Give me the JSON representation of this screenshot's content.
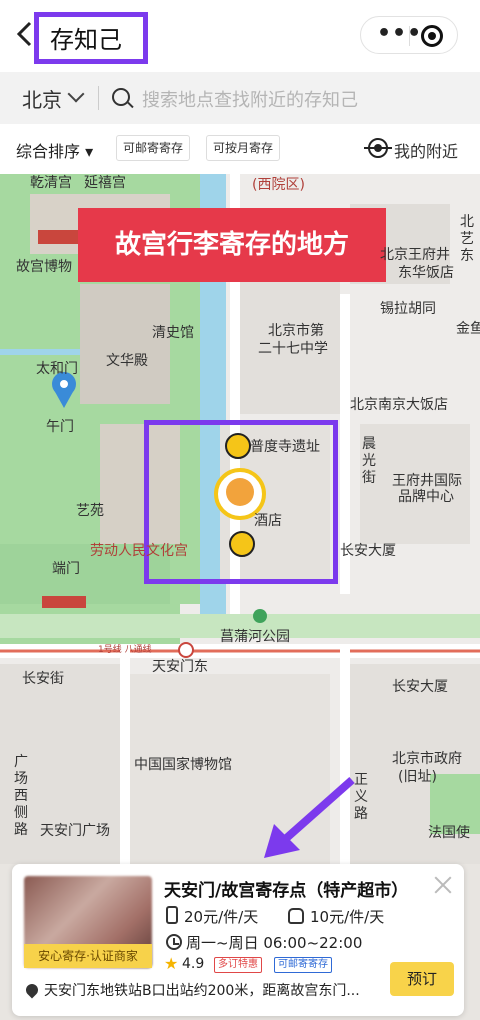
{
  "header": {
    "title": "存知己",
    "more_icon": "more-dots-icon",
    "close_icon": "target-icon"
  },
  "search": {
    "city": "北京",
    "placeholder": "搜索地点查找附近的存知己"
  },
  "filters": {
    "sort": "综合排序 ▾",
    "chip1": "可邮寄寄存",
    "chip2": "可按月寄存",
    "nearby": "我的附近"
  },
  "map": {
    "banner": "故宫行李寄存的地方",
    "labels": {
      "xicheng": "(西院区)",
      "gugong": "故宫博物",
      "qiangong": "乾清宫",
      "yanxi": "延禧宫",
      "wangfujing": "北京王府井",
      "dongfang": "东华饭店",
      "xila": "锡拉胡同",
      "qingshi": "清史馆",
      "wenhua": "文华殿",
      "erqi": "北京市第",
      "erqi2": "二十七中学",
      "jinyu": "金鱼",
      "taihe": "太和门",
      "wumen": "午门",
      "nanjing": "北京南京大饭店",
      "pudu": "普度寺遗址",
      "chenguang": "晨光街",
      "wangfu": "王府井国际",
      "pinpai": "品牌中心",
      "yiyuan": "艺苑",
      "jiudian": "酒店",
      "laodong": "劳动人民文化宫",
      "changan_dasha": "长安大厦",
      "duanmen": "端门",
      "changpu": "菖蒲河公园",
      "line1": "1号线 八通线",
      "changanjie": "长安街",
      "tiananmen_e": "天安门东",
      "changan_dasha2": "长安大厦",
      "museum": "中国国家博物馆",
      "gov": "北京市政府",
      "gov2": "(旧址)",
      "guangchang_xi": "广场西侧路",
      "zhengyi": "正义路",
      "tiananmen_sq": "天安门广场",
      "faguo": "法国使",
      "yiyuan2": "北艺东"
    }
  },
  "store": {
    "name": "天安门/故宫寄存点（特产超市）",
    "tag": "安心寄存·认证商家",
    "price_luggage": "20元/件/天",
    "price_bag": "10元/件/天",
    "hours": "周一~周日 06:00~22:00",
    "rating": "4.9",
    "badge1": "多订特惠",
    "badge2": "可邮寄寄存",
    "address": "天安门东地铁站B口出站约200米，距离故宫东门...",
    "book": "预订"
  },
  "colors": {
    "accent": "#f8d34a",
    "annotation": "#7c3aed",
    "banner": "#e6394a"
  }
}
